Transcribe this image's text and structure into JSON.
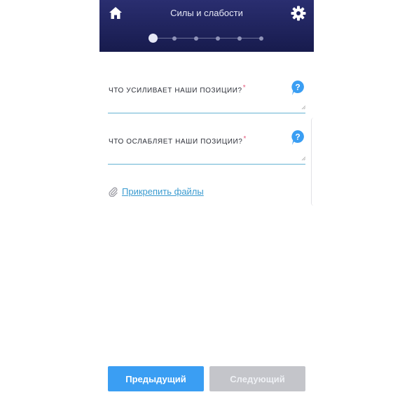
{
  "header": {
    "title": "Силы и слабости",
    "home_icon": "home-icon",
    "settings_icon": "gear-icon",
    "steps_total": 6,
    "active_step": 1
  },
  "fields": [
    {
      "label": "ЧТО УСИЛИВАЕТ НАШИ ПОЗИЦИИ?",
      "required_mark": "*",
      "value": "",
      "help_icon": "help-icon"
    },
    {
      "label": "ЧТО ОСЛАБЛЯЕТ НАШИ ПОЗИЦИИ?",
      "required_mark": "*",
      "value": "",
      "help_icon": "help-icon"
    }
  ],
  "attach": {
    "label": "Прикрепить файлы",
    "icon": "paperclip-icon"
  },
  "buttons": {
    "prev": "Предыдущий",
    "next": "Следующий",
    "next_disabled": true
  },
  "colors": {
    "header_bg": "#1f2460",
    "accent_blue": "#3a9ef3",
    "input_underline": "#66b3d2",
    "required_mark": "#e5567a",
    "link": "#3a9bd0",
    "disabled_button": "#c4c5ca"
  }
}
